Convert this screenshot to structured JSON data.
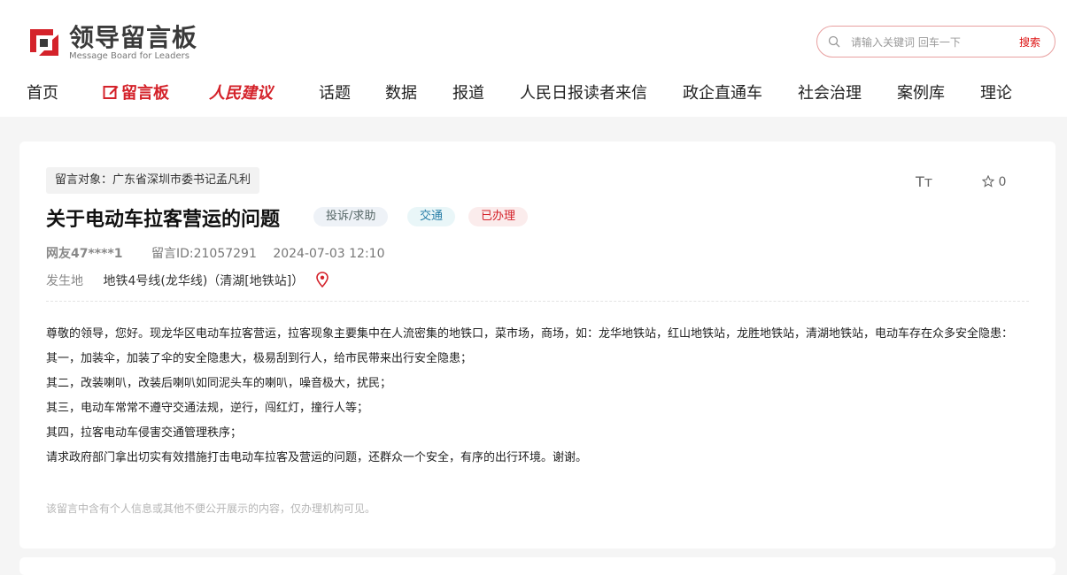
{
  "brand": {
    "title": "领导留言板",
    "subtitle": "Message Board for Leaders"
  },
  "search": {
    "placeholder": "请输入关键词 回车一下",
    "button": "搜索"
  },
  "nav": {
    "items": [
      "首页",
      "留言板",
      "人民建议",
      "话题",
      "数据",
      "报道",
      "人民日报读者来信",
      "政企直通车",
      "社会治理",
      "案例库",
      "理论"
    ]
  },
  "message": {
    "target": "留言对象：广东省深圳市委书记孟凡利",
    "font_tool": "Tт",
    "favorite_count": "0",
    "title": "关于电动车拉客营运的问题",
    "tags": {
      "type": "投诉/求助",
      "field": "交通",
      "status": "已办理"
    },
    "user": "网友47****1",
    "message_id": "留言ID:21057291",
    "datetime": "2024-07-03 12:10",
    "location_label": "发生地",
    "location_value": "地铁4号线(龙华线)（清湖[地铁站]）",
    "body": [
      "尊敬的领导，您好。现龙华区电动车拉客营运，拉客现象主要集中在人流密集的地铁口，菜市场，商场，如：龙华地铁站，红山地铁站，龙胜地铁站，清湖地铁站，电动车存在众多安全隐患：",
      "其一，加装伞，加装了伞的安全隐患大，极易刮到行人，给市民带来出行安全隐患；",
      "其二，改装喇叭，改装后喇叭如同泥头车的喇叭，噪音极大，扰民；",
      "其三，电动车常常不遵守交通法规，逆行，闯红灯，撞行人等；",
      "其四，拉客电动车侵害交通管理秩序；",
      "请求政府部门拿出切实有效措施打击电动车拉客及营运的问题，还群众一个安全，有序的出行环境。谢谢。"
    ],
    "privacy_note": "该留言中含有个人信息或其他不便公开展示的内容，仅办理机构可见。"
  },
  "colors": {
    "accent": "#d4222a",
    "tag_field": "#2a7fa8"
  },
  "icons": [
    "logo-mark-icon",
    "search-icon",
    "edit-icon",
    "star-icon",
    "location-pin-icon"
  ]
}
